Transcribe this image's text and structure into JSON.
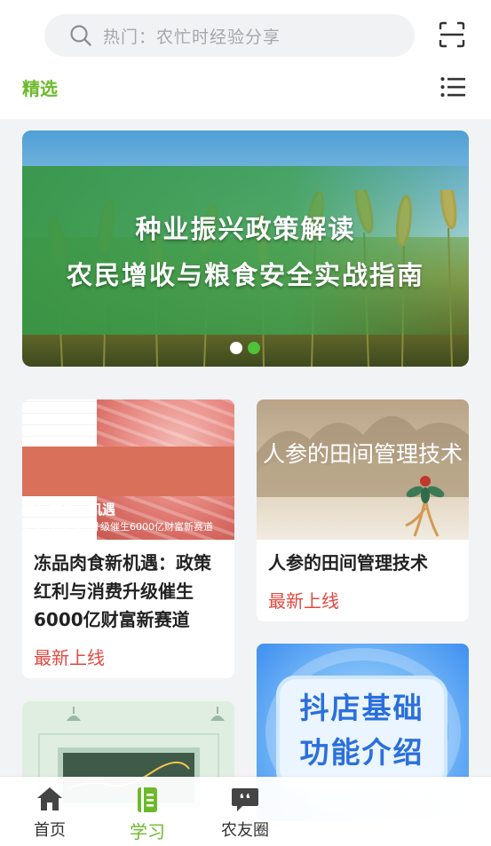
{
  "search": {
    "placeholder": "热门：农忙时经验分享"
  },
  "tabs": {
    "featured": "精选"
  },
  "banner": {
    "line1": "种业振兴政策解读",
    "line2": "农民增收与粮食安全实战指南",
    "total_slides": 2,
    "active_slide": 2
  },
  "cards": [
    {
      "thumb_line1": "冻品肉食新机遇",
      "thumb_line2": "政策红利与消费升级催生6000亿财富新赛道",
      "title": "冻品肉食新机遇：政策红利与消费升级催生6000亿财富新赛道",
      "tag": "最新上线"
    },
    {
      "thumb_title": "人参的田间管理技术",
      "title": "人参的田间管理技术",
      "tag": "最新上线"
    },
    {
      "thumb_line1": "抖店基础",
      "thumb_line2": "功能介绍"
    }
  ],
  "nav": {
    "home": "首页",
    "learn": "学习",
    "community": "农友圈",
    "active": "learn"
  },
  "colors": {
    "accent": "#6cba2b",
    "tag": "#e2483f",
    "active_dot": "#4fc23a"
  }
}
